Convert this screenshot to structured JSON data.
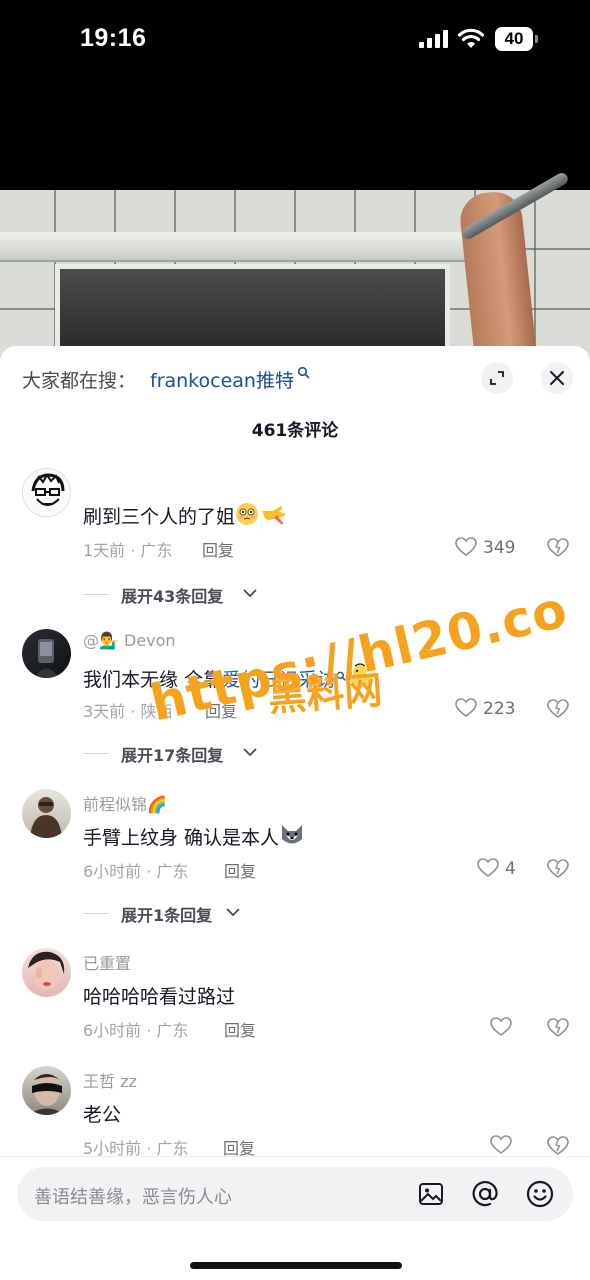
{
  "status_bar": {
    "time": "19:16",
    "battery": "40",
    "icons": [
      "signal-icon",
      "wifi-icon",
      "battery-icon"
    ]
  },
  "video": {
    "description_icon": "video-player"
  },
  "search_bar": {
    "prefix": "大家都在搜：",
    "term": "frankocean推特",
    "term_icon": "search-icon",
    "expand_icon": "expand-icon",
    "close_icon": "close-icon"
  },
  "comments_header": {
    "count_text": "461条评论"
  },
  "comments": [
    {
      "author": "",
      "text": "刷到三个人的了姐",
      "emojis": [
        "flushed-emoji",
        "pointing-hand-emoji"
      ],
      "meta": "1天前 · 广东",
      "reply": "回复",
      "likes": "349",
      "expand_replies": "展开43条回复"
    },
    {
      "author": "@💁‍♂️ Devon",
      "text_plain": "我们本无缘 全靠",
      "text_link": "爱的日记采访",
      "emojis": [
        "duck-emoji"
      ],
      "meta": "3天前 · 陕西",
      "reply": "回复",
      "likes": "223",
      "expand_replies": "展开17条回复"
    },
    {
      "author": "前程似锦🌈",
      "text": "手臂上纹身 确认是本人",
      "emojis": [
        "husky-emoji"
      ],
      "meta": "6小时前 · 广东",
      "reply": "回复",
      "likes": "4",
      "expand_replies": "展开1条回复"
    },
    {
      "author": "已重置",
      "text": "哈哈哈哈看过路过",
      "meta": "6小时前 · 广东",
      "reply": "回复",
      "likes": ""
    },
    {
      "author": "王哲 zz",
      "text": "老公",
      "meta": "5小时前 · 广东",
      "reply": "回复",
      "likes": ""
    }
  ],
  "watermark": {
    "title": "黑料网",
    "url": "https://hl20.co"
  },
  "input_bar": {
    "placeholder": "善语结善缘，恶言伤人心",
    "icons": [
      "image-icon",
      "at-icon",
      "emoji-icon"
    ]
  },
  "colors": {
    "link": "#1a4f8f",
    "watermark": "#f7a21c",
    "sheet_bg": "#ffffff",
    "input_bg": "#f2f2f4"
  }
}
